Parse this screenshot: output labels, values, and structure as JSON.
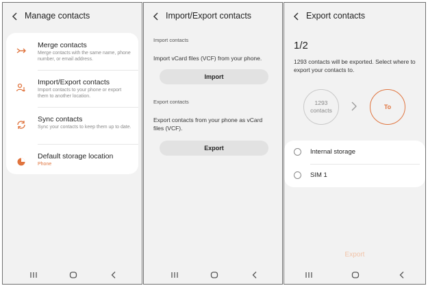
{
  "screen1": {
    "title": "Manage contacts",
    "items": [
      {
        "icon": "merge-icon",
        "title": "Merge contacts",
        "subtitle": "Merge contacts with the same name, phone number, or email address."
      },
      {
        "icon": "import-export-icon",
        "title": "Import/Export contacts",
        "subtitle": "Import contacts to your phone or export them to another location."
      },
      {
        "icon": "sync-icon",
        "title": "Sync contacts",
        "subtitle": "Sync your contacts to keep them up to date."
      },
      {
        "icon": "storage-pie-icon",
        "title": "Default storage location",
        "subtitle": "Phone"
      }
    ]
  },
  "screen2": {
    "title": "Import/Export contacts",
    "import_section": "Import contacts",
    "import_text": "Import vCard files (VCF) from your phone.",
    "import_button": "Import",
    "export_section": "Export contacts",
    "export_text": "Export contacts from your phone as vCard files (VCF).",
    "export_button": "Export"
  },
  "screen3": {
    "title": "Export contacts",
    "step": "1/2",
    "description": "1293 contacts will be exported. Select where to export your contacts to.",
    "source_count": "1293",
    "source_label": "contacts",
    "target_label": "To",
    "options": [
      "Internal storage",
      "SIM 1"
    ],
    "export_button": "Export"
  },
  "colors": {
    "accent": "#e0743e",
    "accent_disabled": "#f1c3a8",
    "background": "#f2f2f2",
    "card": "#ffffff"
  }
}
